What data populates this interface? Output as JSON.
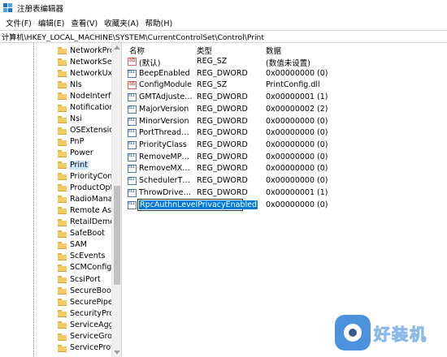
{
  "window": {
    "title": "注册表编辑器",
    "icon": "regedit-icon"
  },
  "menu": [
    "文件(F)",
    "编辑(E)",
    "查看(V)",
    "收藏夹(A)",
    "帮助(H)"
  ],
  "address": "计算机\\HKEY_LOCAL_MACHINE\\SYSTEM\\CurrentControlSet\\Control\\Print",
  "tree": {
    "items": [
      {
        "label": "NetworkProv"
      },
      {
        "label": "NetworkSetu"
      },
      {
        "label": "NetworkUxM"
      },
      {
        "label": "Nls"
      },
      {
        "label": "NodeInterfac"
      },
      {
        "label": "Notifications"
      },
      {
        "label": "Nsi"
      },
      {
        "label": "OSExtensionI"
      },
      {
        "label": "PnP"
      },
      {
        "label": "Power"
      },
      {
        "label": "Print",
        "selected": true
      },
      {
        "label": "PriorityContro"
      },
      {
        "label": "ProductOptic"
      },
      {
        "label": "RadioManag"
      },
      {
        "label": "Remote Assis"
      },
      {
        "label": "RetailDemo"
      },
      {
        "label": "SafeBoot"
      },
      {
        "label": "SAM"
      },
      {
        "label": "ScEvents"
      },
      {
        "label": "SCMConfig"
      },
      {
        "label": "ScsiPort"
      },
      {
        "label": "SecureBoot"
      },
      {
        "label": "SecurePipeSe"
      },
      {
        "label": "SecurityProvi"
      },
      {
        "label": "ServiceAggre"
      },
      {
        "label": "ServiceGroup"
      },
      {
        "label": "ServiceProvic"
      }
    ]
  },
  "list": {
    "headers": {
      "name": "名称",
      "type": "类型",
      "data": "数据"
    },
    "rows": [
      {
        "name": "(默认)",
        "type": "REG_SZ",
        "data": "(数值未设置)",
        "icon": "string-value-icon"
      },
      {
        "name": "BeepEnabled",
        "type": "REG_DWORD",
        "data": "0x00000000 (0)",
        "icon": "dword-value-icon"
      },
      {
        "name": "ConfigModule",
        "type": "REG_SZ",
        "data": "PrintConfig.dll",
        "icon": "string-value-icon"
      },
      {
        "name": "GMTAdjustedF...",
        "type": "REG_DWORD",
        "data": "0x00000001 (1)",
        "icon": "dword-value-icon"
      },
      {
        "name": "MajorVersion",
        "type": "REG_DWORD",
        "data": "0x00000002 (2)",
        "icon": "dword-value-icon"
      },
      {
        "name": "MinorVersion",
        "type": "REG_DWORD",
        "data": "0x00000000 (0)",
        "icon": "dword-value-icon"
      },
      {
        "name": "PortThreadPri...",
        "type": "REG_DWORD",
        "data": "0x00000000 (0)",
        "icon": "dword-value-icon"
      },
      {
        "name": "PriorityClass",
        "type": "REG_DWORD",
        "data": "0x00000000 (0)",
        "icon": "dword-value-icon"
      },
      {
        "name": "RemoveMPDW",
        "type": "REG_DWORD",
        "data": "0x00000000 (0)",
        "icon": "dword-value-icon"
      },
      {
        "name": "RemoveMXDW",
        "type": "REG_DWORD",
        "data": "0x00000000 (0)",
        "icon": "dword-value-icon"
      },
      {
        "name": "SchedulerThre...",
        "type": "REG_DWORD",
        "data": "0x00000000 (0)",
        "icon": "dword-value-icon"
      },
      {
        "name": "ThrowDriverEx...",
        "type": "REG_DWORD",
        "data": "0x00000001 (1)",
        "icon": "dword-value-icon"
      }
    ],
    "editing_row": {
      "name": "RpcAuthnLevelPrivacyEnabled",
      "data": "0x00000000 (0)",
      "icon": "dword-value-icon"
    }
  },
  "watermark": {
    "text": "好装机",
    "color": "#2e7fd6"
  }
}
